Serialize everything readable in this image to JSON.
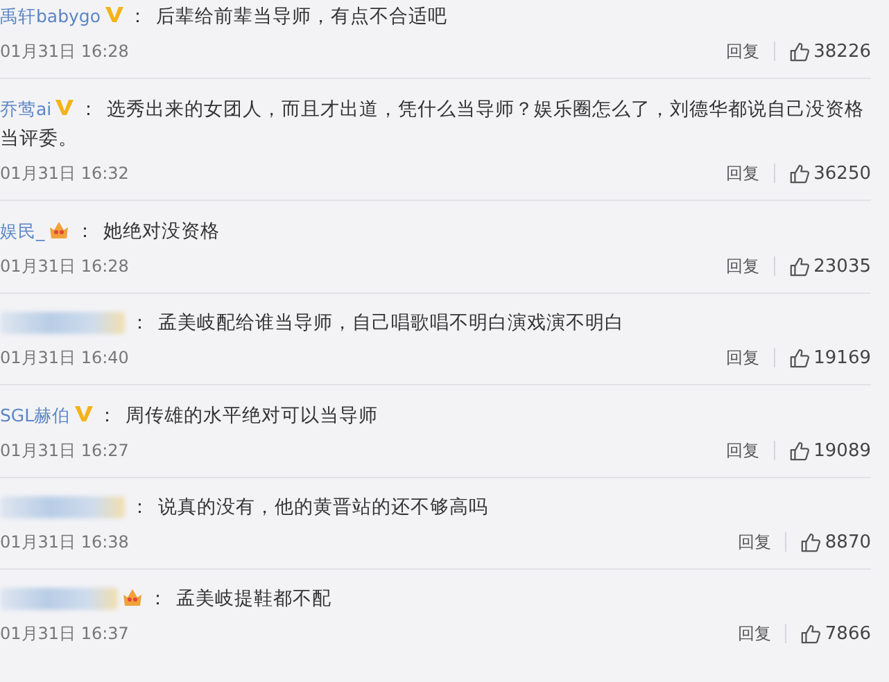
{
  "comments": [
    {
      "user": "禹轩babygo",
      "verified": true,
      "crown": false,
      "name_blurred": false,
      "colon": "：",
      "text": "后辈给前辈当导师，有点不合适吧",
      "time": "01月31日 16:28",
      "reply": "回复",
      "likes": "38226"
    },
    {
      "user": "乔莺ai",
      "verified": true,
      "crown": false,
      "name_blurred": false,
      "colon": "：",
      "text": "选秀出来的女团人，而且才出道，凭什么当导师？娱乐圈怎么了，刘德华都说自己没资格当评委。",
      "time": "01月31日 16:32",
      "reply": "回复",
      "likes": "36250"
    },
    {
      "user": "娱民_",
      "verified": false,
      "crown": true,
      "name_blurred": false,
      "colon": "：",
      "text": "她绝对没资格",
      "time": "01月31日 16:28",
      "reply": "回复",
      "likes": "23035"
    },
    {
      "verified": false,
      "crown": false,
      "name_blurred": true,
      "colon": "：",
      "text": "孟美岐配给谁当导师，自己唱歌唱不明白演戏演不明白",
      "time": "01月31日 16:40",
      "reply": "回复",
      "likes": "19169"
    },
    {
      "user": "SGL赫伯",
      "verified": true,
      "crown": false,
      "name_blurred": false,
      "colon": "：",
      "text": "周传雄的水平绝对可以当导师",
      "time": "01月31日 16:27",
      "reply": "回复",
      "likes": "19089"
    },
    {
      "verified": false,
      "crown": false,
      "name_blurred": true,
      "colon": "：",
      "text": "说真的没有，他的黄晋站的还不够高吗",
      "time": "01月31日 16:38",
      "reply": "回复",
      "likes": "8870"
    },
    {
      "verified": false,
      "crown": true,
      "name_blurred": true,
      "colon": "：",
      "text": "孟美岐提鞋都不配",
      "time": "01月31日 16:37",
      "reply": "回复",
      "likes": "7866"
    }
  ]
}
